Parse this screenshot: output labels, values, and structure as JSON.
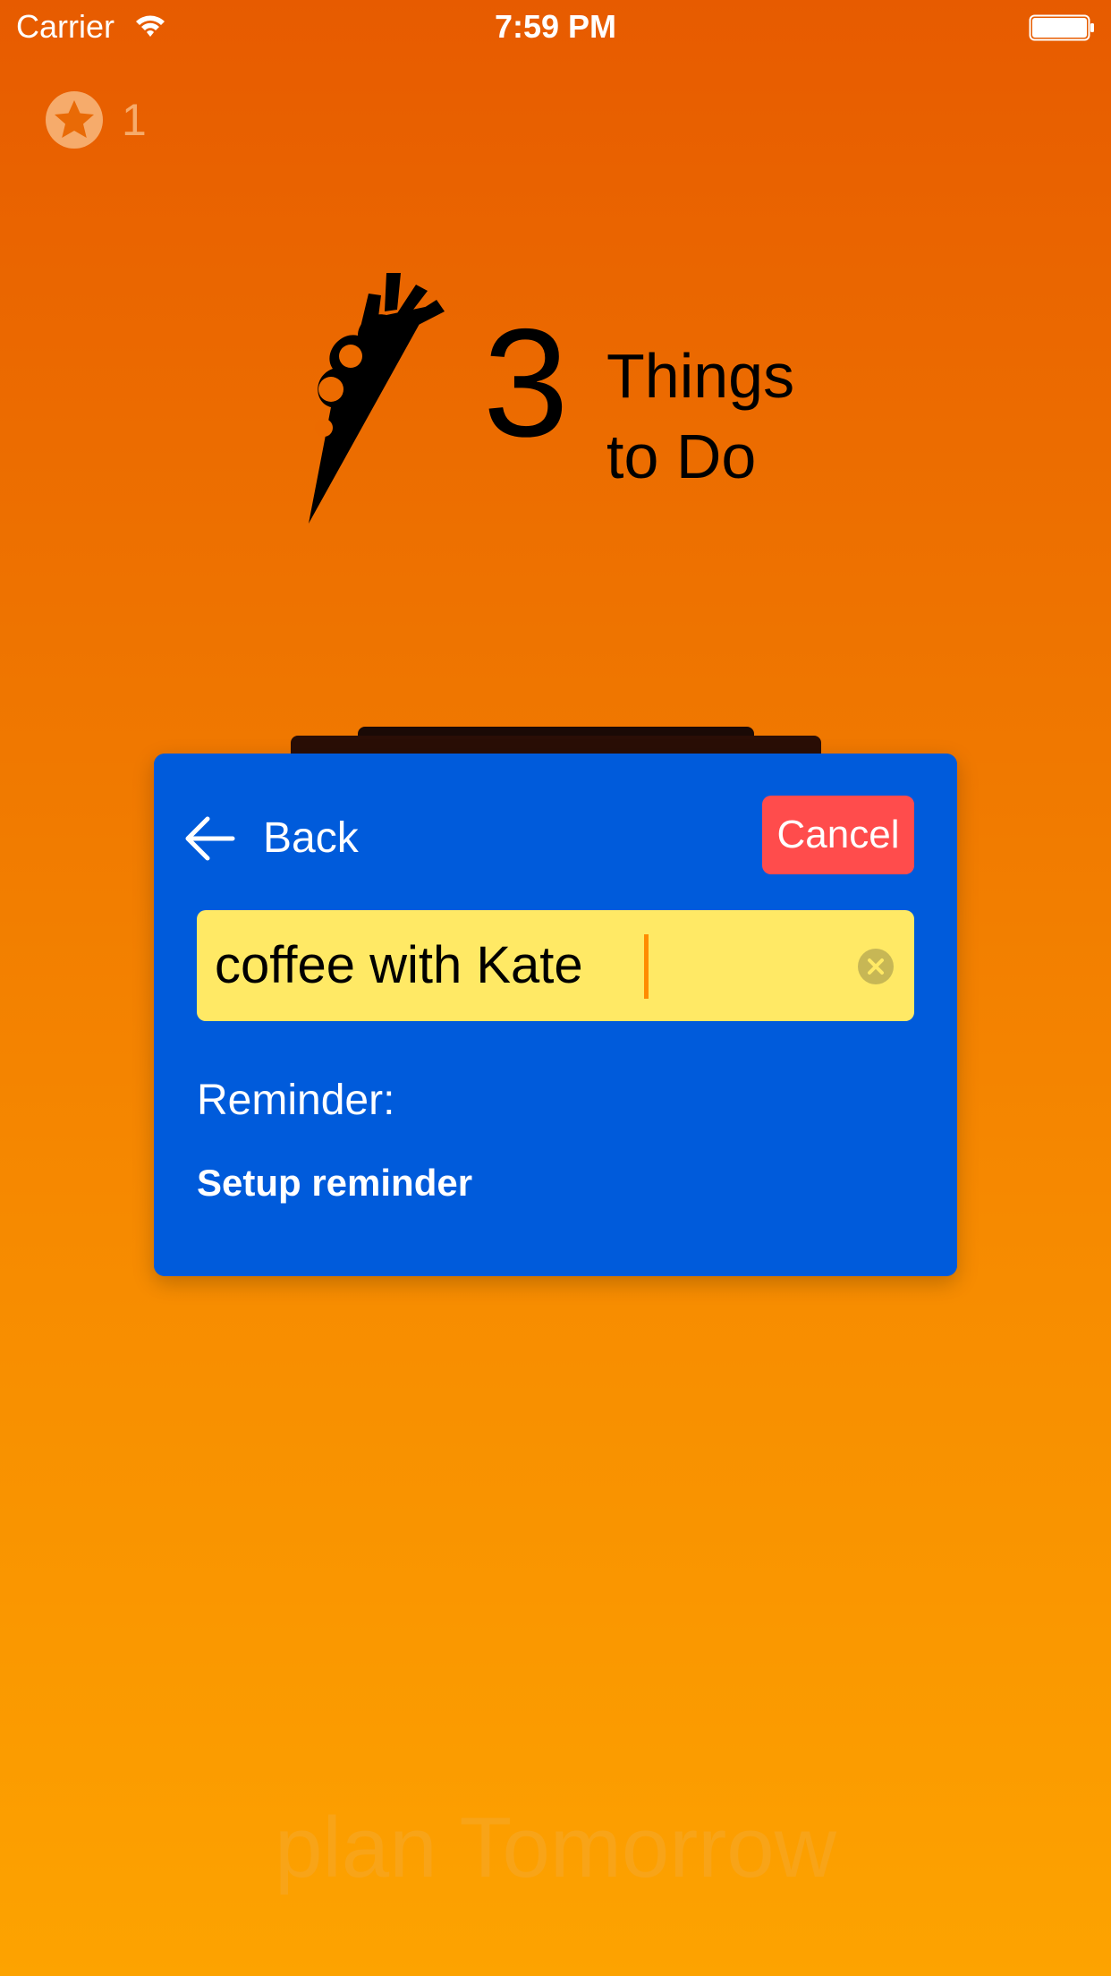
{
  "status_bar": {
    "carrier": "Carrier",
    "time": "7:59 PM",
    "wifi_icon": "wifi-icon",
    "battery_icon": "battery-full-icon"
  },
  "points": {
    "icon": "star-icon",
    "count": "1"
  },
  "logo": {
    "number": "3",
    "line1": "Things",
    "line2": "to Do"
  },
  "dialog": {
    "back_label": "Back",
    "back_icon": "arrow-left-icon",
    "cancel_label": "Cancel",
    "task_input_value": "coffee with Kate",
    "clear_icon": "clear-circle-icon",
    "reminder_label": "Reminder:",
    "setup_reminder_label": "Setup reminder"
  },
  "footer": {
    "plan_tomorrow_label": "plan Tomorrow"
  },
  "colors": {
    "background_top": "#e75b00",
    "background_bottom": "#fda300",
    "dialog_background": "#005bdb",
    "cancel_button": "#ff4c4c",
    "input_background": "#ffe965",
    "caret": "#ff8c00"
  }
}
